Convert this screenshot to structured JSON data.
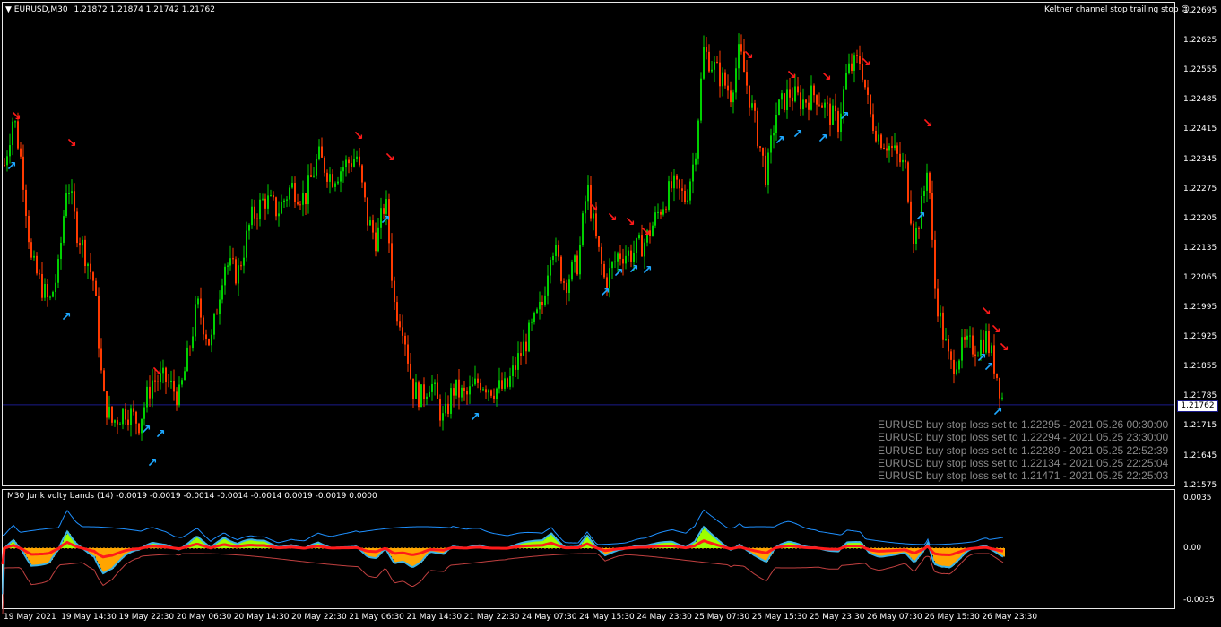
{
  "header": {
    "symbol": "EURUSD,M30",
    "ohlc": "1.21872 1.21874 1.21742 1.21762",
    "indicator_name": "Keltner channel stop trailing stop",
    "menu_icon": "triangle-down-icon",
    "smiley_icon": "smiley-icon"
  },
  "current_price": "1.21762",
  "price_axis": [
    "1.22695",
    "1.22625",
    "1.22555",
    "1.22485",
    "1.22415",
    "1.22345",
    "1.22275",
    "1.22205",
    "1.22135",
    "1.22065",
    "1.21995",
    "1.21925",
    "1.21855",
    "1.21785",
    "1.21715",
    "1.21645",
    "1.21575"
  ],
  "indicator": {
    "title": "M30 Jurik volty bands (14) -0.0019 -0.0019 -0.0014 -0.0014 -0.0014 0.0019 -0.0019 0.0000",
    "axis": [
      "0.0035",
      "0.00",
      "-0.0035"
    ]
  },
  "time_axis": [
    "19 May 2021",
    "19 May 14:30",
    "19 May 22:30",
    "20 May 06:30",
    "20 May 14:30",
    "20 May 22:30",
    "21 May 06:30",
    "21 May 14:30",
    "21 May 22:30",
    "24 May 07:30",
    "24 May 15:30",
    "24 May 23:30",
    "25 May 07:30",
    "25 May 15:30",
    "25 May 23:30",
    "26 May 07:30",
    "26 May 15:30",
    "26 May 23:30"
  ],
  "log_lines": [
    "EURUSD buy stop loss set to 1.22295 - 2021.05.26 00:30:00",
    "EURUSD buy stop loss set to 1.22294 - 2021.05.25 23:30:00",
    "EURUSD buy stop loss set to 1.22289 - 2021.05.25 22:52:39",
    "EURUSD buy stop loss set to 1.22134 - 2021.05.25 22:25:04",
    "EURUSD buy stop loss set to 1.21471 - 2021.05.25 22:25:03"
  ],
  "colors": {
    "bull": "#00d000",
    "bear": "#ff3a00",
    "up_arrow": "#1ea8ff",
    "down_arrow": "#ff1a1a",
    "hist_pos": "#9cff00",
    "hist_neg": "#ffa500",
    "outline": "#3cb4e6",
    "price_line": "#1a1a8a"
  }
}
